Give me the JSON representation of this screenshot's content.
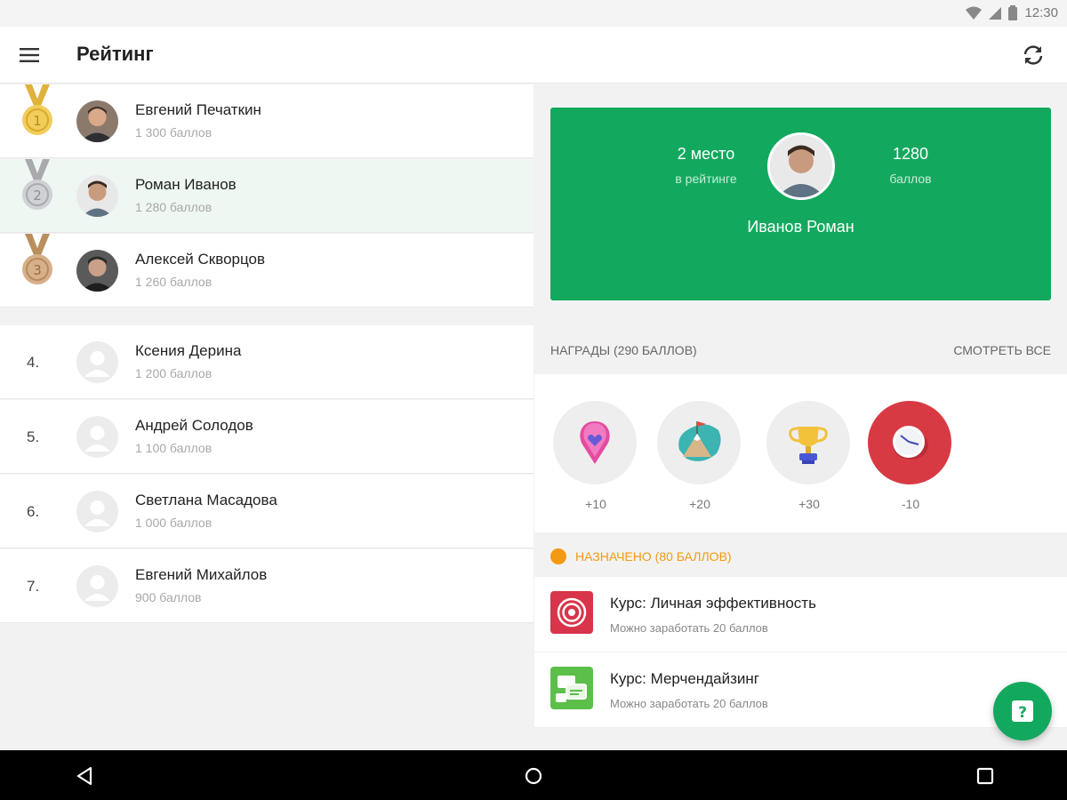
{
  "status": {
    "time": "12:30"
  },
  "appbar": {
    "title": "Рейтинг",
    "menu_icon": "menu-icon",
    "refresh_icon": "refresh-icon"
  },
  "leaderboard": [
    {
      "rank": "1",
      "name": "Евгений Печаткин",
      "points": "1 300 баллов",
      "medal": "gold"
    },
    {
      "rank": "2",
      "name": "Роман Иванов",
      "points": "1 280 баллов",
      "medal": "silver",
      "selected": true
    },
    {
      "rank": "3",
      "name": "Алексей Скворцов",
      "points": "1 260 баллов",
      "medal": "bronze"
    },
    {
      "rank": "4.",
      "name": "Ксения Дерина",
      "points": "1 200 баллов"
    },
    {
      "rank": "5.",
      "name": "Андрей Солодов",
      "points": "1 100 баллов"
    },
    {
      "rank": "6.",
      "name": "Светлана Масадова",
      "points": "1 000 баллов"
    },
    {
      "rank": "7.",
      "name": "Евгений Михайлов",
      "points": "900 баллов"
    }
  ],
  "profile": {
    "place": "2 место",
    "place_sub": "в рейтинге",
    "score": "1280",
    "score_sub": "баллов",
    "name": "Иванов Роман"
  },
  "rewards": {
    "header": "НАГРАДЫ (290 БАЛЛОВ)",
    "view_all": "СМОТРЕТЬ ВСЕ",
    "items": [
      {
        "icon": "heart-pin-icon",
        "value": "+10"
      },
      {
        "icon": "mountain-flag-icon",
        "value": "+20"
      },
      {
        "icon": "trophy-icon",
        "value": "+30"
      },
      {
        "icon": "clock-icon",
        "value": "-10"
      }
    ]
  },
  "assigned": {
    "label": "НАЗНАЧЕНО (80 БАЛЛОВ)",
    "courses": [
      {
        "title": "Курс: Личная эффективность",
        "subtitle": "Можно заработать 20 баллов",
        "icon": "target-icon"
      },
      {
        "title": "Курс: Мерчендайзинг",
        "subtitle": "Можно заработать 20 баллов",
        "icon": "merch-icon"
      }
    ]
  },
  "fab": {
    "icon": "help-icon"
  },
  "navbar": {
    "back": "back-icon",
    "home": "home-icon",
    "recents": "recents-icon"
  },
  "colors": {
    "accent": "#12a95e",
    "assigned": "#f39a12",
    "reward_negative": "#d83a44"
  }
}
